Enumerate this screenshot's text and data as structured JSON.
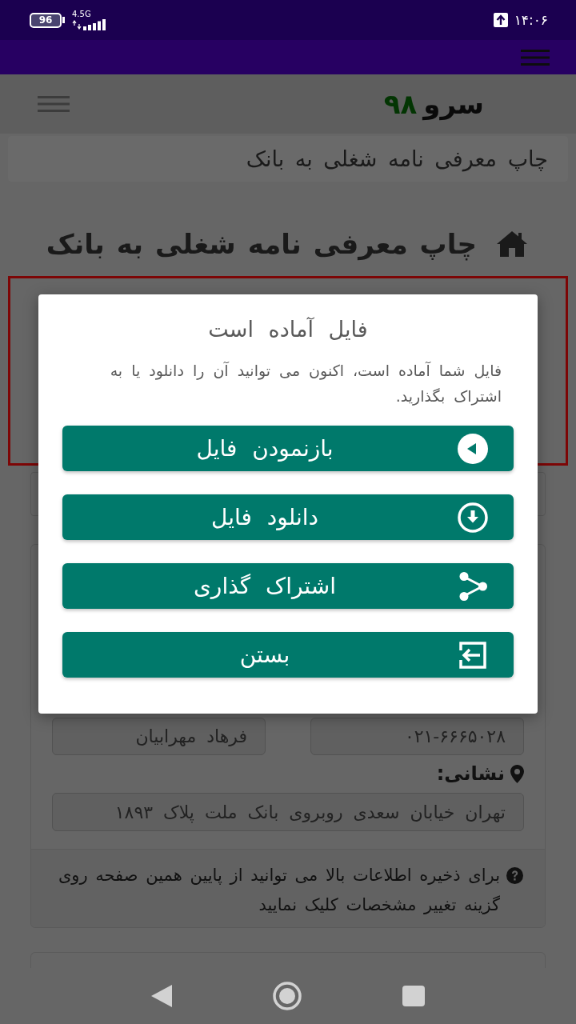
{
  "status_bar": {
    "battery": "96",
    "network": "4.5G",
    "time": "۱۴:۰۶"
  },
  "header": {
    "logo": {
      "name": "سرو",
      "number": "۹۸"
    }
  },
  "breadcrumb": {
    "text": "چاپ معرفی نامه شغلی به بانک"
  },
  "page": {
    "title": "چاپ معرفی نامه شغلی به بانک"
  },
  "form": {
    "fields": [
      {
        "value": "۰۲۱-۶۶۶۵۰۲۸"
      },
      {
        "value": "فرهاد مهرابیان"
      }
    ],
    "address": {
      "label": "نشانی:",
      "value": "تهران خیابان سعدی روبروی بانک ملت پلاک ۱۸۹۳"
    },
    "help": "برای ذخیره اطلاعات بالا می توانید از پایین همین صفحه روی گزینه تغییر مشخصات کلیک نمایید"
  },
  "dialog": {
    "title": "فایل آماده است",
    "message": "فایل شما آماده است، اکنون می توانید آن را دانلود یا به اشتراک بگذارید.",
    "buttons": [
      {
        "label": "بازنمودن فایل",
        "kind": "open"
      },
      {
        "label": "دانلود فایل",
        "kind": "download"
      },
      {
        "label": "اشتراک گذاری",
        "kind": "share"
      },
      {
        "label": "بستن",
        "kind": "close"
      }
    ]
  }
}
